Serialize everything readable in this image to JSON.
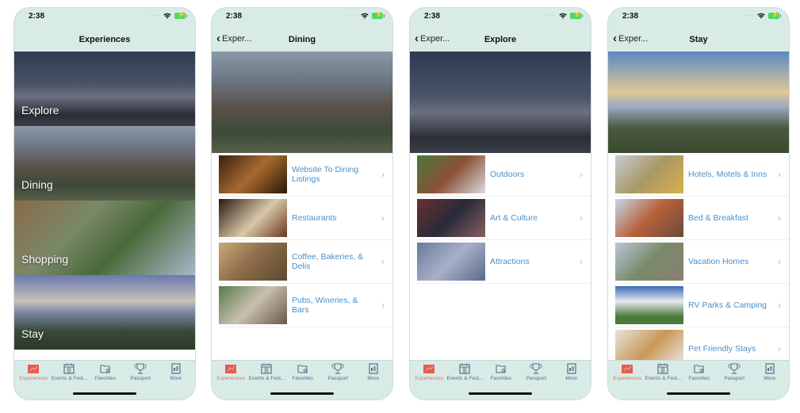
{
  "status": {
    "time": "2:38"
  },
  "tabbar": {
    "items": [
      {
        "label": "Experiences",
        "icon": "map-icon",
        "active": true
      },
      {
        "label": "Events & Fest...",
        "icon": "calendar-icon",
        "active": false
      },
      {
        "label": "Favorites",
        "icon": "folder-star-icon",
        "active": false
      },
      {
        "label": "Passport",
        "icon": "trophy-icon",
        "active": false
      },
      {
        "label": "More",
        "icon": "book-icon",
        "active": false
      }
    ],
    "active_color": "#e57368",
    "inactive_color": "#5a6f8a"
  },
  "screens": [
    {
      "title": "Experiences",
      "tiles": [
        {
          "label": "Explore"
        },
        {
          "label": "Dining"
        },
        {
          "label": "Shopping"
        },
        {
          "label": "Stay"
        }
      ]
    },
    {
      "title": "Dining",
      "back_label": "Exper...",
      "items": [
        {
          "label": "Website To Dining Listings"
        },
        {
          "label": "Restaurants"
        },
        {
          "label": "Coffee, Bakeries, & Delis"
        },
        {
          "label": "Pubs, Wineries, & Bars"
        }
      ]
    },
    {
      "title": "Explore",
      "back_label": "Exper...",
      "items": [
        {
          "label": "Outdoors"
        },
        {
          "label": "Art & Culture"
        },
        {
          "label": "Attractions"
        }
      ]
    },
    {
      "title": "Stay",
      "back_label": "Exper...",
      "items": [
        {
          "label": "Hotels, Motels & Inns"
        },
        {
          "label": "Bed & Breakfast"
        },
        {
          "label": "Vacation Homes"
        },
        {
          "label": "RV Parks & Camping"
        },
        {
          "label": "Pet Friendly Stays"
        }
      ]
    }
  ],
  "link_color": "#4a90c8",
  "nav_bg_color": "#d8ebe6"
}
